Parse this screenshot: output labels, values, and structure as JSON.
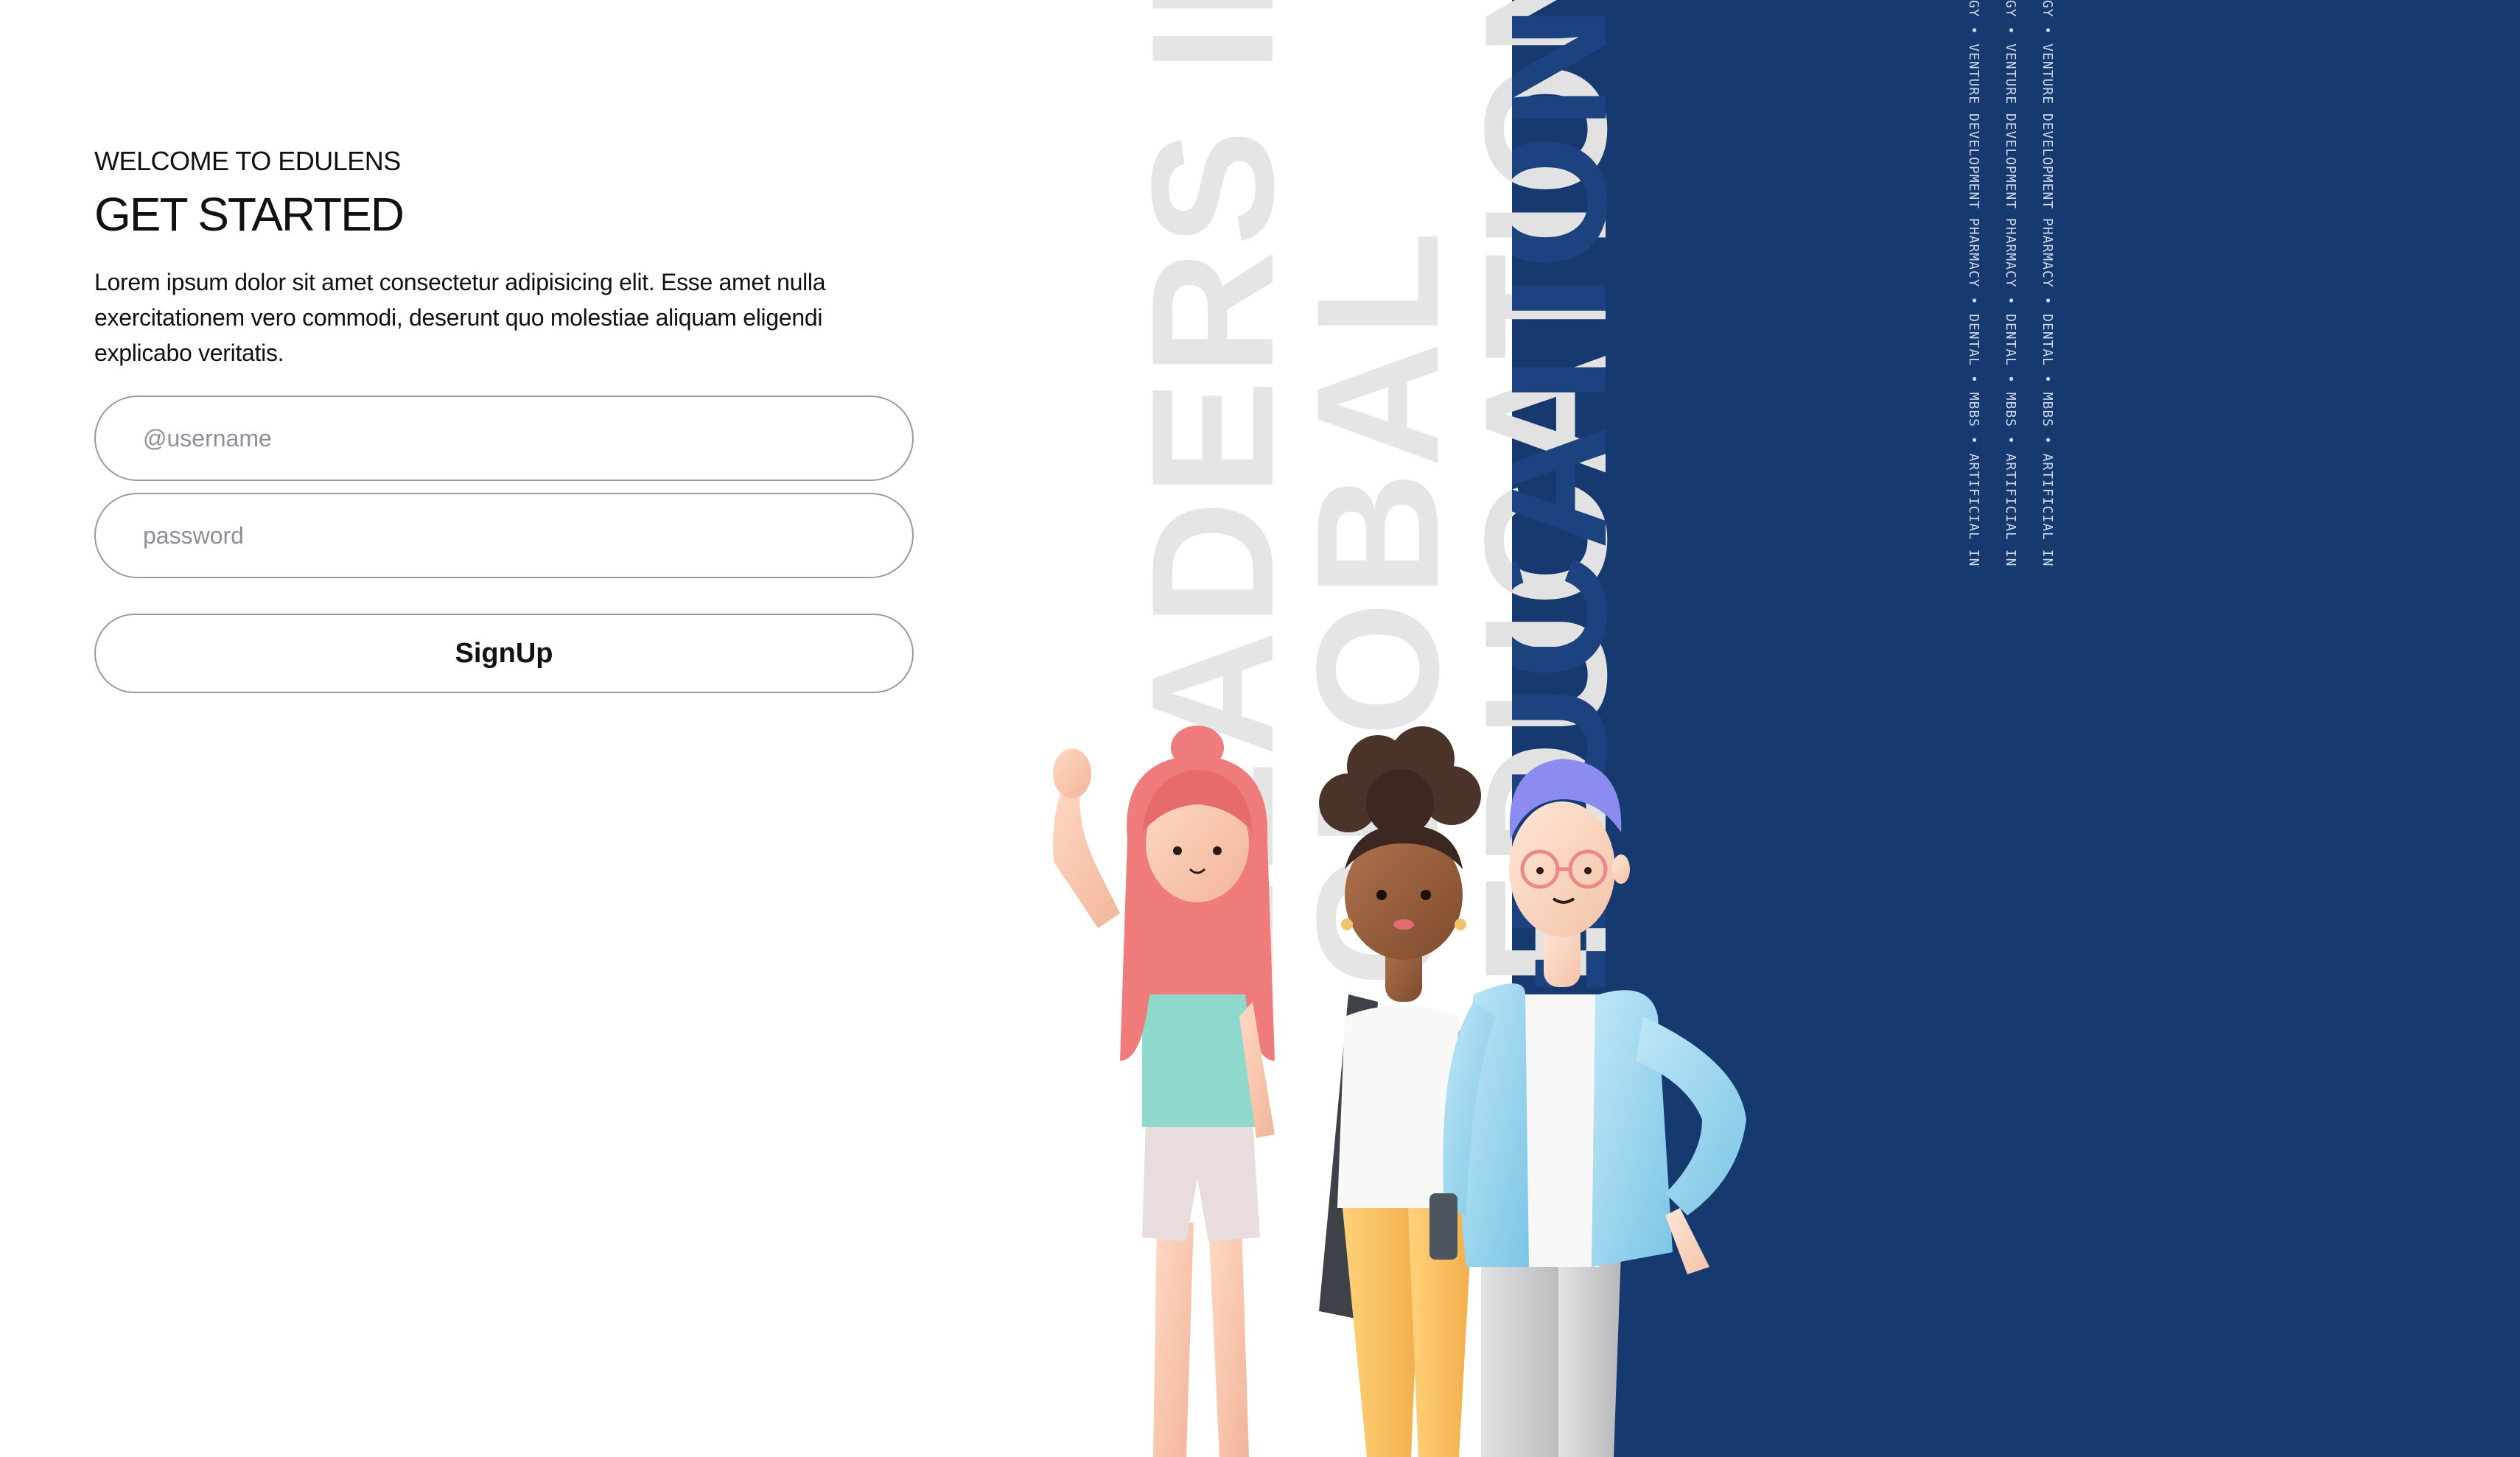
{
  "form": {
    "eyebrow": "WELCOME TO EDULENS",
    "title": "GET STARTED",
    "intro": "Lorem ipsum dolor sit amet consectetur adipisicing elit. Esse amet nulla exercitationem vero commodi, deserunt quo molestiae aliquam eligendi explicabo veritatis.",
    "username_placeholder": "@username",
    "password_placeholder": "password",
    "signup_label": "SignUp"
  },
  "art": {
    "words": [
      "LEADERS IN",
      "GLOBAL",
      "EDUCATION"
    ],
    "ticker": [
      "GY • VENTURE DEVELOPMENT PHARMACY • DENTAL • MBBS • ARTIFICIAL INTELLIGENCE",
      "GY • VENTURE DEVELOPMENT PHARMACY • DENTAL • MBBS • ARTIFICIAL INTELLIGENCE",
      "GY • VENTURE DEVELOPMENT PHARMACY • DENTAL • MBBS • ARTIFICIAL INTELLIGENCE"
    ]
  },
  "colors": {
    "navy": "#163a70",
    "ghost_text": "#e5e5e5",
    "border": "#9a9a9a",
    "placeholder": "#8a8f98"
  }
}
